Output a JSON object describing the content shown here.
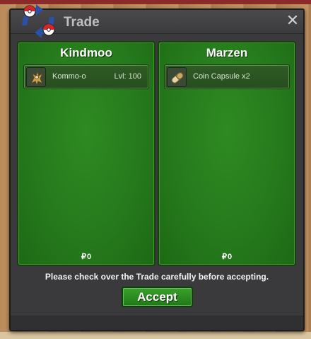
{
  "window": {
    "title": "Trade",
    "close_glyph": "✕"
  },
  "left_panel": {
    "player_name": "Kindmoo",
    "items": [
      {
        "icon": "creature-kommo-o-icon",
        "label": "Kommo-o",
        "level": "Lvl: 100"
      }
    ],
    "money_symbol": "₽",
    "money": "0"
  },
  "right_panel": {
    "player_name": "Marzen",
    "items": [
      {
        "icon": "coin-capsule-icon",
        "label": "Coin Capsule  x2"
      }
    ],
    "money_symbol": "₽",
    "money": "0"
  },
  "notice": "Please check over the Trade carefully before accepting.",
  "accept_label": "Accept",
  "colors": {
    "panel_green": "#267a1c",
    "accept_green": "#2e8c22",
    "window_bg": "#3a3a3c"
  }
}
